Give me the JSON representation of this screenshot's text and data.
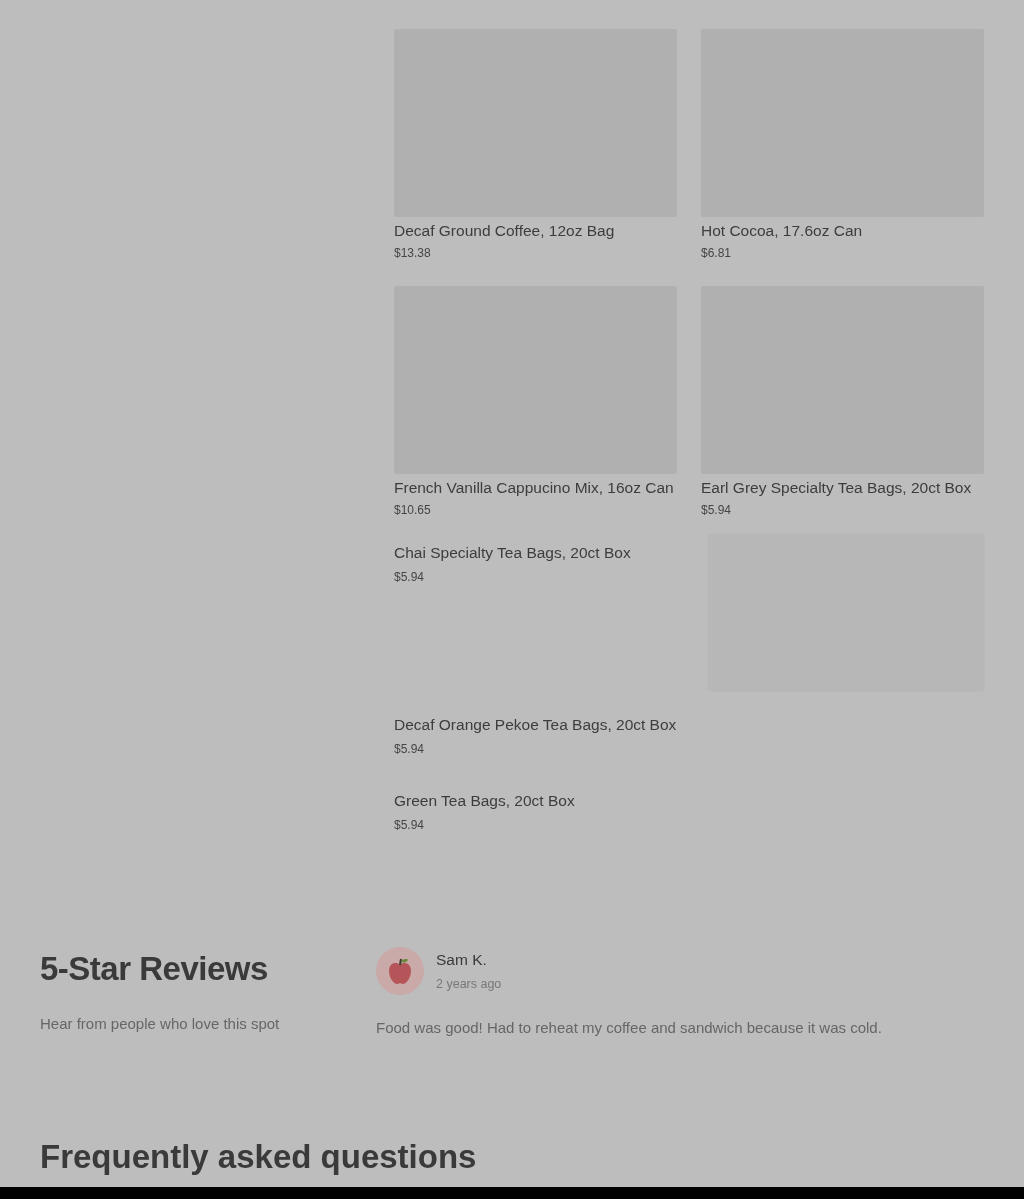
{
  "menu_items": [
    {
      "kind": "image",
      "name": "Decaf Ground Coffee, 12oz Bag",
      "price": "$13.38"
    },
    {
      "kind": "image",
      "name": "Hot Cocoa, 17.6oz Can",
      "price": "$6.81"
    },
    {
      "kind": "image",
      "name": "French Vanilla Cappucino Mix, 16oz Can",
      "price": "$10.65"
    },
    {
      "kind": "image",
      "name": "Earl Grey Specialty Tea Bags, 20ct Box",
      "price": "$5.94"
    },
    {
      "kind": "text",
      "name": "Chai Specialty Tea Bags, 20ct Box",
      "price": "$5.94"
    },
    {
      "kind": "skeleton"
    },
    {
      "kind": "text",
      "name": "Decaf Orange Pekoe Tea Bags, 20ct Box",
      "price": "$5.94"
    },
    {
      "kind": "text",
      "name": "Green Tea Bags, 20ct Box",
      "price": "$5.94"
    }
  ],
  "reviews_section": {
    "title": "5-Star Reviews",
    "subtitle": "Hear from people who love this spot",
    "reviews": [
      {
        "author": "Sam K.",
        "time": "2 years ago",
        "text": "Food was good! Had to reheat my coffee and sandwich because it was cold."
      }
    ]
  },
  "faq_section": {
    "title": "Frequently asked questions"
  }
}
